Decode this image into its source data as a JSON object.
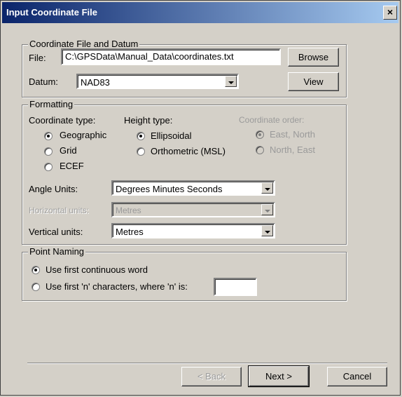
{
  "window": {
    "title": "Input Coordinate File",
    "close_label": "×"
  },
  "file_datum": {
    "group_title": "Coordinate File and Datum",
    "file_label": "File:",
    "file_value": "C:\\GPSData\\Manual_Data\\coordinates.txt",
    "browse_label": "Browse",
    "datum_label": "Datum:",
    "datum_value": "NAD83",
    "view_label": "View"
  },
  "formatting": {
    "group_title": "Formatting",
    "coord_type_label": "Coordinate type:",
    "coord_types": [
      "Geographic",
      "Grid",
      "ECEF"
    ],
    "coord_type_selected": "Geographic",
    "height_type_label": "Height type:",
    "height_types": [
      "Ellipsoidal",
      "Orthometric (MSL)"
    ],
    "height_type_selected": "Ellipsoidal",
    "coord_order_label": "Coordinate order:",
    "coord_orders": [
      "East, North",
      "North, East"
    ],
    "coord_order_selected": "East, North",
    "angle_units_label": "Angle Units:",
    "angle_units_value": "Degrees Minutes Seconds",
    "horizontal_units_label": "Horizontal units:",
    "horizontal_units_value": "Metres",
    "vertical_units_label": "Vertical units:",
    "vertical_units_value": "Metres"
  },
  "point_naming": {
    "group_title": "Point Naming",
    "option_first_word": "Use first continuous word",
    "option_first_n": "Use first 'n' characters, where 'n' is:",
    "selected": "Use first continuous word",
    "n_value": ""
  },
  "footer": {
    "back_label": "< Back",
    "next_label": "Next >",
    "cancel_label": "Cancel"
  }
}
